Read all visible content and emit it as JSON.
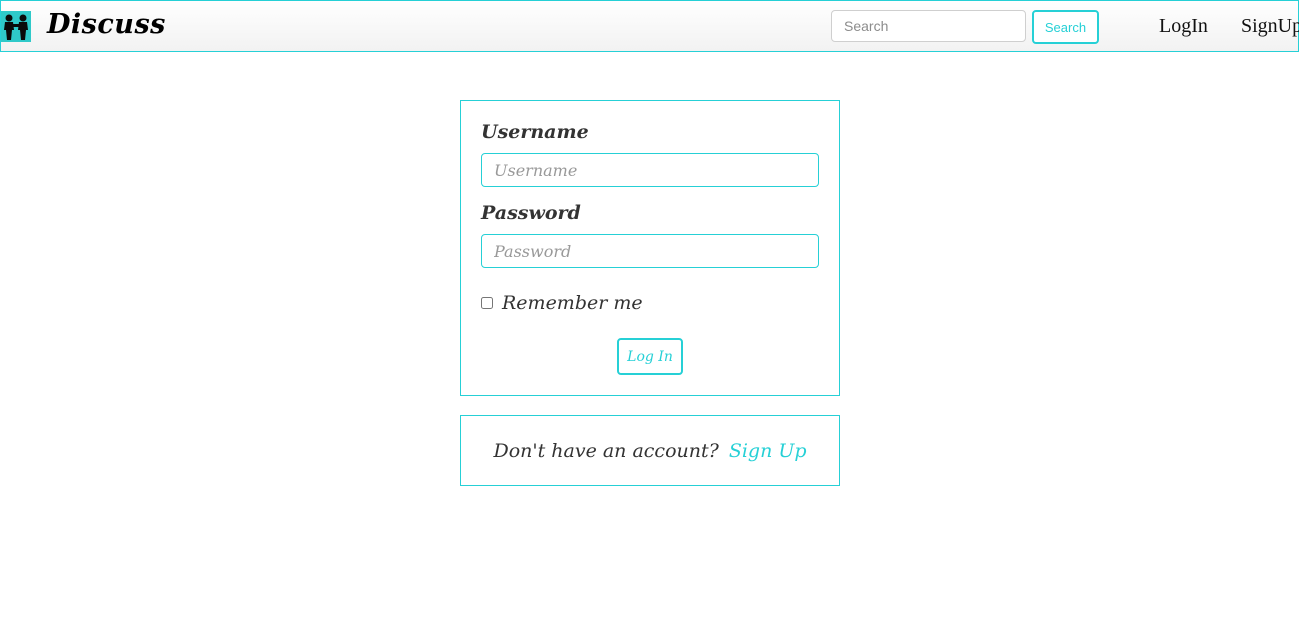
{
  "colors": {
    "accent": "#26d0d6",
    "logo_bg": "#2fc9c9",
    "text": "#333333"
  },
  "navbar": {
    "logo_icon": "two-people-icon",
    "brand": "Discuss",
    "search": {
      "placeholder": "Search",
      "value": ""
    },
    "search_button": "Search",
    "login_link": "LogIn",
    "signup_link": "SignUp"
  },
  "login_form": {
    "username_label": "Username",
    "username_placeholder": "Username",
    "password_label": "Password",
    "password_placeholder": "Password",
    "remember_label": "Remember me",
    "remember_checked": false,
    "submit": "Log In"
  },
  "signup_prompt": {
    "text": "Don't have an account?",
    "link": "Sign Up"
  }
}
